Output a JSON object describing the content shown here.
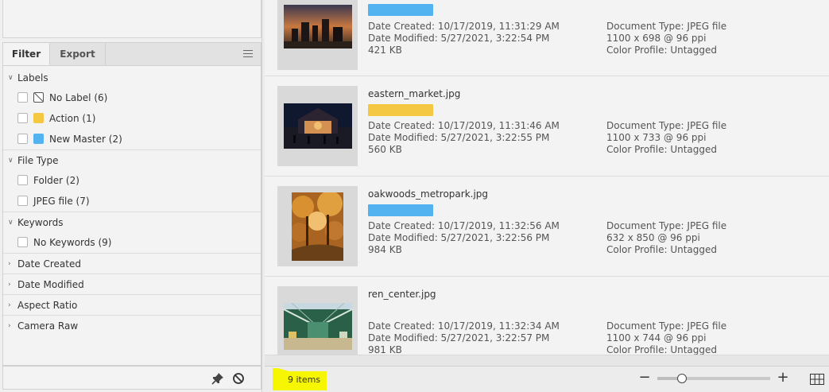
{
  "tabs": {
    "filter": "Filter",
    "export": "Export"
  },
  "filter_sections": {
    "labels": {
      "title": "Labels",
      "items": [
        {
          "label": "No Label (6)",
          "color": "none"
        },
        {
          "label": "Action (1)",
          "color": "#f4c842"
        },
        {
          "label": "New Master (2)",
          "color": "#52b3f0"
        }
      ]
    },
    "file_type": {
      "title": "File Type",
      "items": [
        {
          "label": "Folder (2)"
        },
        {
          "label": "JPEG file (7)"
        }
      ]
    },
    "keywords": {
      "title": "Keywords",
      "items": [
        {
          "label": "No Keywords (9)"
        }
      ]
    },
    "date_created": {
      "title": "Date Created"
    },
    "date_modified": {
      "title": "Date Modified"
    },
    "aspect_ratio": {
      "title": "Aspect Ratio"
    },
    "camera_raw": {
      "title": "Camera Raw"
    }
  },
  "items": [
    {
      "name": "",
      "label_color": "#52b3f0",
      "date_created": "Date Created: 10/17/2019, 11:31:29 AM",
      "date_modified": "Date Modified: 5/27/2021, 3:22:54 PM",
      "size": "421 KB",
      "doc_type": "Document Type: JPEG file",
      "dimensions": "1100 x 698 @ 96 ppi",
      "color_profile": "Color Profile: Untagged"
    },
    {
      "name": "eastern_market.jpg",
      "label_color": "#f4c842",
      "date_created": "Date Created: 10/17/2019, 11:31:46 AM",
      "date_modified": "Date Modified: 5/27/2021, 3:22:55 PM",
      "size": "560 KB",
      "doc_type": "Document Type: JPEG file",
      "dimensions": "1100 x 733 @ 96 ppi",
      "color_profile": "Color Profile: Untagged"
    },
    {
      "name": "oakwoods_metropark.jpg",
      "label_color": "#52b3f0",
      "date_created": "Date Created: 10/17/2019, 11:32:56 AM",
      "date_modified": "Date Modified: 5/27/2021, 3:22:56 PM",
      "size": "984 KB",
      "doc_type": "Document Type: JPEG file",
      "dimensions": "632 x 850 @ 96 ppi",
      "color_profile": "Color Profile: Untagged"
    },
    {
      "name": "ren_center.jpg",
      "label_color": "",
      "date_created": "Date Created: 10/17/2019, 11:32:34 AM",
      "date_modified": "Date Modified: 5/27/2021, 3:22:57 PM",
      "size": "981 KB",
      "doc_type": "Document Type: JPEG file",
      "dimensions": "1100 x 744 @ 96 ppi",
      "color_profile": "Color Profile: Untagged"
    }
  ],
  "status": {
    "count": "9 items",
    "zoom_level": 0.22
  },
  "icons": {
    "menu": "hamburger-menu-icon",
    "pin": "pin-icon",
    "clear": "clear-filter-icon",
    "grid": "grid-view-icon"
  }
}
